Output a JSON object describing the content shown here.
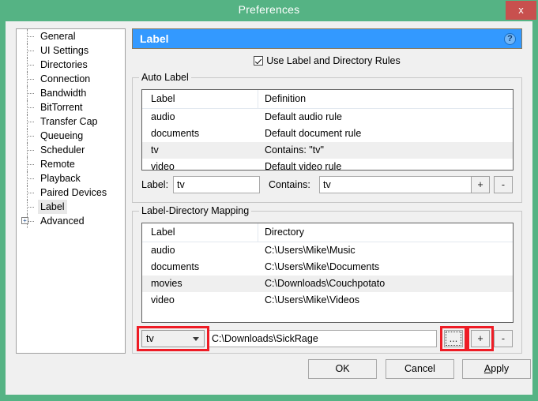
{
  "window": {
    "title": "Preferences",
    "close_label": "x",
    "frame_color": "#55b384",
    "close_color": "#c8504e"
  },
  "sidebar": {
    "items": [
      {
        "label": "General",
        "selected": false,
        "expandable": false
      },
      {
        "label": "UI Settings",
        "selected": false,
        "expandable": false
      },
      {
        "label": "Directories",
        "selected": false,
        "expandable": false
      },
      {
        "label": "Connection",
        "selected": false,
        "expandable": false
      },
      {
        "label": "Bandwidth",
        "selected": false,
        "expandable": false
      },
      {
        "label": "BitTorrent",
        "selected": false,
        "expandable": false
      },
      {
        "label": "Transfer Cap",
        "selected": false,
        "expandable": false
      },
      {
        "label": "Queueing",
        "selected": false,
        "expandable": false
      },
      {
        "label": "Scheduler",
        "selected": false,
        "expandable": false
      },
      {
        "label": "Remote",
        "selected": false,
        "expandable": false
      },
      {
        "label": "Playback",
        "selected": false,
        "expandable": false
      },
      {
        "label": "Paired Devices",
        "selected": false,
        "expandable": false
      },
      {
        "label": "Label",
        "selected": true,
        "expandable": false
      },
      {
        "label": "Advanced",
        "selected": false,
        "expandable": true,
        "expander": "+"
      }
    ]
  },
  "pane": {
    "header_title": "Label",
    "header_color": "#3399ff",
    "help_icon": "question-mark",
    "use_rules": {
      "label": "Use Label and Directory Rules",
      "checked": true
    }
  },
  "auto_label": {
    "group_title": "Auto Label",
    "columns": [
      "Label",
      "Definition"
    ],
    "rows": [
      {
        "label": "audio",
        "definition": "Default audio rule",
        "selected": false
      },
      {
        "label": "documents",
        "definition": "Default document rule",
        "selected": false
      },
      {
        "label": "tv",
        "definition": "Contains: \"tv\"",
        "selected": true
      },
      {
        "label": "video",
        "definition": "Default video rule",
        "selected": false
      }
    ],
    "edit_row": {
      "label_caption": "Label:",
      "label_value": "tv",
      "contains_caption": "Contains:",
      "contains_value": "tv",
      "add_button": "+",
      "remove_button": "-"
    }
  },
  "mapping": {
    "group_title": "Label-Directory Mapping",
    "columns": [
      "Label",
      "Directory"
    ],
    "rows": [
      {
        "label": "audio",
        "directory": "C:\\Users\\Mike\\Music",
        "selected": false
      },
      {
        "label": "documents",
        "directory": "C:\\Users\\Mike\\Documents",
        "selected": false
      },
      {
        "label": "movies",
        "directory": "C:\\Downloads\\Couchpotato",
        "selected": true
      },
      {
        "label": "video",
        "directory": "C:\\Users\\Mike\\Videos",
        "selected": false
      }
    ],
    "edit_row": {
      "selected_label": "tv",
      "directory_value": "C:\\Downloads\\SickRage",
      "browse_button": "...",
      "add_button": "+",
      "remove_button": "-"
    }
  },
  "annotations": {
    "highlight_color": "#ee1c25",
    "boxes": [
      "label-dropdown",
      "browse-button",
      "add-mapping-button"
    ]
  },
  "footer": {
    "ok": "OK",
    "cancel": "Cancel",
    "apply_accel": "A",
    "apply_rest": "pply"
  }
}
